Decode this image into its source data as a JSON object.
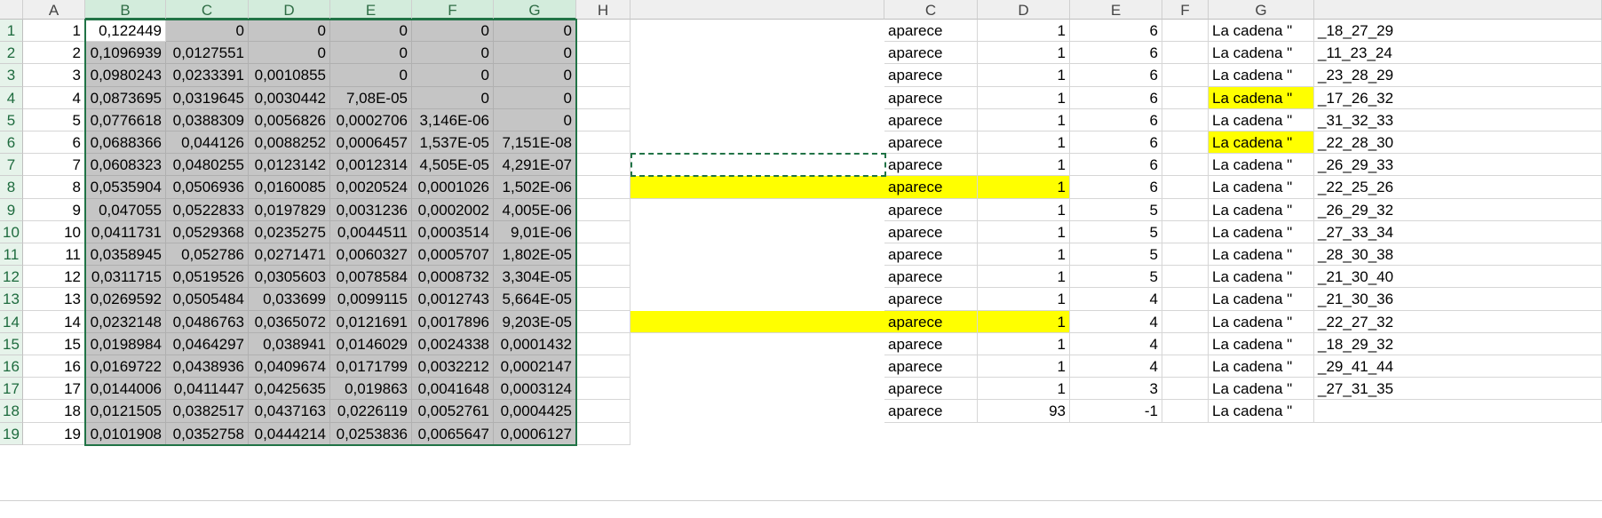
{
  "left_sheet": {
    "col_headers": [
      "A",
      "B",
      "C",
      "D",
      "E",
      "F",
      "G",
      "H"
    ],
    "rows": [
      [
        "1",
        "0,122449",
        "0",
        "0",
        "0",
        "0",
        "0"
      ],
      [
        "2",
        "0,1096939",
        "0,0127551",
        "0",
        "0",
        "0",
        "0"
      ],
      [
        "3",
        "0,0980243",
        "0,0233391",
        "0,0010855",
        "0",
        "0",
        "0"
      ],
      [
        "4",
        "0,0873695",
        "0,0319645",
        "0,0030442",
        "7,08E-05",
        "0",
        "0"
      ],
      [
        "5",
        "0,0776618",
        "0,0388309",
        "0,0056826",
        "0,0002706",
        "3,146E-06",
        "0"
      ],
      [
        "6",
        "0,0688366",
        "0,044126",
        "0,0088252",
        "0,0006457",
        "1,537E-05",
        "7,151E-08"
      ],
      [
        "7",
        "0,0608323",
        "0,0480255",
        "0,0123142",
        "0,0012314",
        "4,505E-05",
        "4,291E-07"
      ],
      [
        "8",
        "0,0535904",
        "0,0506936",
        "0,0160085",
        "0,0020524",
        "0,0001026",
        "1,502E-06"
      ],
      [
        "9",
        "0,047055",
        "0,0522833",
        "0,0197829",
        "0,0031236",
        "0,0002002",
        "4,005E-06"
      ],
      [
        "10",
        "0,0411731",
        "0,0529368",
        "0,0235275",
        "0,0044511",
        "0,0003514",
        "9,01E-06"
      ],
      [
        "11",
        "0,0358945",
        "0,052786",
        "0,0271471",
        "0,0060327",
        "0,0005707",
        "1,802E-05"
      ],
      [
        "12",
        "0,0311715",
        "0,0519526",
        "0,0305603",
        "0,0078584",
        "0,0008732",
        "3,304E-05"
      ],
      [
        "13",
        "0,0269592",
        "0,0505484",
        "0,033699",
        "0,0099115",
        "0,0012743",
        "5,664E-05"
      ],
      [
        "14",
        "0,0232148",
        "0,0486763",
        "0,0365072",
        "0,0121691",
        "0,0017896",
        "9,203E-05"
      ],
      [
        "15",
        "0,0198984",
        "0,0464297",
        "0,038941",
        "0,0146029",
        "0,0024338",
        "0,0001432"
      ],
      [
        "16",
        "0,0169722",
        "0,0438936",
        "0,0409674",
        "0,0171799",
        "0,0032212",
        "0,0002147"
      ],
      [
        "17",
        "0,0144006",
        "0,0411447",
        "0,0425635",
        "0,019863",
        "0,0041648",
        "0,0003124"
      ],
      [
        "18",
        "0,0121505",
        "0,0382517",
        "0,0437163",
        "0,0226119",
        "0,0052761",
        "0,0004425"
      ],
      [
        "19",
        "0,0101908",
        "0,0352758",
        "0,0444214",
        "0,0253836",
        "0,0065647",
        "0,0006127"
      ]
    ]
  },
  "right_sheet": {
    "col_headers": [
      "C",
      "D",
      "E",
      "F",
      "G"
    ],
    "rows": [
      [
        "aparece",
        "1",
        "6",
        "",
        "La cadena \"",
        "_18_27_29"
      ],
      [
        "aparece",
        "1",
        "6",
        "",
        "La cadena \"",
        "_11_23_24"
      ],
      [
        "aparece",
        "1",
        "6",
        "",
        "La cadena \"",
        "_23_28_29"
      ],
      [
        "aparece",
        "1",
        "6",
        "",
        "La cadena \"",
        "_17_26_32"
      ],
      [
        "aparece",
        "1",
        "6",
        "",
        "La cadena \"",
        "_31_32_33"
      ],
      [
        "aparece",
        "1",
        "6",
        "",
        "La cadena \"",
        "_22_28_30"
      ],
      [
        "aparece",
        "1",
        "6",
        "",
        "La cadena \"",
        "_26_29_33"
      ],
      [
        "aparece",
        "1",
        "6",
        "",
        "La cadena \"",
        "_22_25_26"
      ],
      [
        "aparece",
        "1",
        "5",
        "",
        "La cadena \"",
        "_26_29_32"
      ],
      [
        "aparece",
        "1",
        "5",
        "",
        "La cadena \"",
        "_27_33_34"
      ],
      [
        "aparece",
        "1",
        "5",
        "",
        "La cadena \"",
        "_28_30_38"
      ],
      [
        "aparece",
        "1",
        "5",
        "",
        "La cadena \"",
        "_21_30_40"
      ],
      [
        "aparece",
        "1",
        "4",
        "",
        "La cadena \"",
        "_21_30_36"
      ],
      [
        "aparece",
        "1",
        "4",
        "",
        "La cadena \"",
        "_22_27_32"
      ],
      [
        "aparece",
        "1",
        "4",
        "",
        "La cadena \"",
        "_18_29_32"
      ],
      [
        "aparece",
        "1",
        "4",
        "",
        "La cadena \"",
        "_29_41_44"
      ],
      [
        "aparece",
        "1",
        "3",
        "",
        "La cadena \"",
        "_27_31_35"
      ],
      [
        "aparece",
        "93",
        "-1",
        "",
        "La cadena \"",
        ""
      ]
    ],
    "yellow_g_rows": [
      3,
      5
    ],
    "yellow_cd_rows": [
      7,
      13
    ]
  },
  "colors": {
    "selection": "#217346",
    "highlight": "#ffff00",
    "grey": "#c5c5c5"
  }
}
